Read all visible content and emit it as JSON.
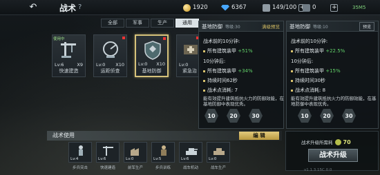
{
  "header": {
    "back_icon": "back-arrow-icon",
    "title": "战术",
    "help": "?"
  },
  "resources": {
    "gold": "1920",
    "gems": "6367",
    "fuel": "149/100",
    "power": "0",
    "battery": "35M5"
  },
  "tabs": [
    {
      "label": "全部"
    },
    {
      "label": "军事"
    },
    {
      "label": "生产"
    },
    {
      "label": "通用",
      "active": true
    }
  ],
  "cards": [
    {
      "name": "快速建造",
      "level": "Lv:6",
      "count": "X9",
      "in_use": "使用中"
    },
    {
      "name": "运距侦查",
      "level": "Lv:0",
      "count": "X10"
    },
    {
      "name": "基地防御",
      "level": "Lv:0",
      "count": "X10",
      "selected": true
    },
    {
      "name": "紧急治",
      "level": "Lv:0",
      "count": ""
    }
  ],
  "left_panel": {
    "title": "基地防御",
    "sub": "等级:30",
    "link": "满级预览",
    "head1": "战术前的10分钟:",
    "line1": "所有建筑装甲",
    "val1": "+51%",
    "head2": "10分钟后:",
    "line2": "所有建筑装甲",
    "val2": "+34%",
    "line3": "持续时间62秒",
    "line4": "战术点消耗: 7",
    "desc": "能有效提升建筑抵抗火力的防御效能，在基地防御中表现优秀。",
    "hex": [
      "10",
      "20",
      "30"
    ]
  },
  "right_panel": {
    "title": "基地防御",
    "sub": "等级:10",
    "btn": "预览",
    "head1": "战术前的10分钟:",
    "line1": "所有建筑装甲",
    "val1": "+22.5%",
    "head2": "10分钟后:",
    "line2": "所有建筑装甲",
    "val2": "+15%",
    "line3": "持续时间30秒",
    "line4": "战术点消耗: 8",
    "desc": "能有效提升建筑抵抗火力的防御效能，在基地防御中表现优秀。",
    "hex": [
      "10",
      "20",
      "30"
    ]
  },
  "usage": {
    "label": "战术使用",
    "edit": "编 辑",
    "slots": [
      {
        "name": "步兵突击",
        "level": "Lv:4"
      },
      {
        "name": "快速建造",
        "level": "Lv:6"
      },
      {
        "name": "前军生产",
        "level": "Lv:0"
      },
      {
        "name": "步兵训练",
        "level": "Lv:5"
      },
      {
        "name": "战车机动",
        "level": "Lv:6"
      },
      {
        "name": "战车生产",
        "level": "Lv:0"
      }
    ]
  },
  "upgrade": {
    "cost_label": "战术升级所需耗",
    "cost": "70",
    "button": "战术升级"
  },
  "version": "v1.1.3.15C.0.0"
}
